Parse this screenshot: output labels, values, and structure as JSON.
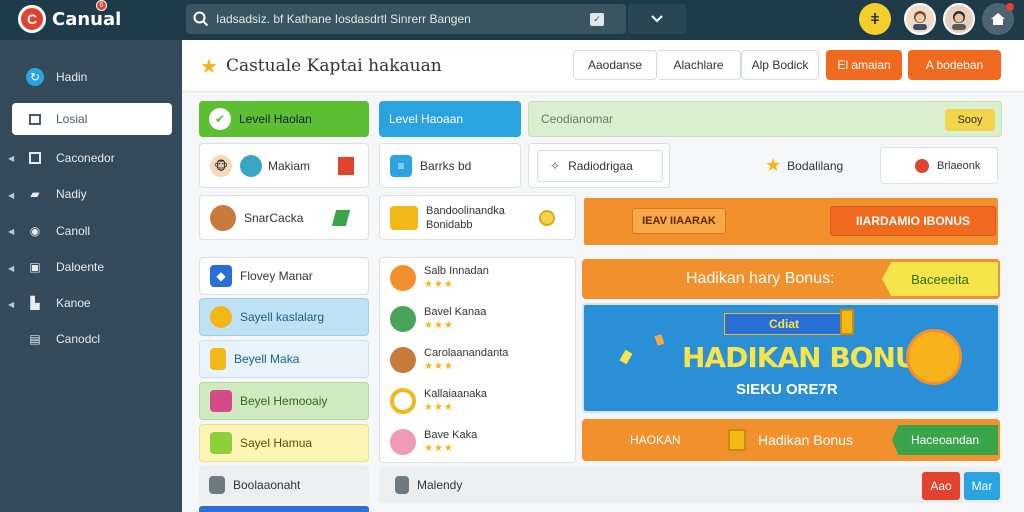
{
  "app": {
    "name": "Canual",
    "badge": "6",
    "logo_glyph": "C"
  },
  "search": {
    "value": "Iadsadsiz. bf Kathane Iosdasdrtl Sinrerr Bangen"
  },
  "topbar": {
    "yellow_badge": "ǂ"
  },
  "sidebar": {
    "items": [
      {
        "label": "Hadin",
        "icon": "refresh-icon"
      },
      {
        "label": "Losial",
        "icon": "square-icon"
      },
      {
        "label": "Caconedor",
        "icon": "calendar-icon"
      },
      {
        "label": "Nadiy",
        "icon": "folder-icon"
      },
      {
        "label": "Canoll",
        "icon": "eye-icon"
      },
      {
        "label": "Daloente",
        "icon": "image-icon"
      },
      {
        "label": "Kanoe",
        "icon": "chart-icon"
      },
      {
        "label": "Canodcl",
        "icon": "list-icon"
      }
    ]
  },
  "header": {
    "title": "Castuale Kaptai hakauan",
    "buttons": [
      "Aaodanse",
      "Alachlare",
      "Alp Bodick",
      "El amaian",
      "A bodeban"
    ]
  },
  "row1": {
    "green": "Leveil Haolan",
    "blue": "Level Haoaan",
    "search_value": "Ceodianomar",
    "search_btn": "Sooy"
  },
  "row2": {
    "card1": "Makiam",
    "card2": "Barrks bd",
    "card3": "Radiodrigaa",
    "card4": "Bodalilang",
    "card5": "Brlaeonk"
  },
  "row3": {
    "card1": "SnarCacka",
    "card2_line1": "Bandoolinandka",
    "card2_line2": "Bonidabb",
    "banner_left": "IEAV IIAARAK",
    "banner_right": "IIARDAMIO IBONUS"
  },
  "left_list": [
    {
      "label": "Flovey Manar"
    },
    {
      "label": "Sayell kaslalarg"
    },
    {
      "label": "Beyell Maka"
    },
    {
      "label": "Beyel Hemooaiy"
    },
    {
      "label": "Sayel Hamua"
    },
    {
      "label": "Boolaaonaht"
    }
  ],
  "mid_list": [
    {
      "label": "Salb Innadan",
      "stars": "★★★"
    },
    {
      "label": "Bavel Kanaa",
      "stars": "★★★"
    },
    {
      "label": "Carolaanandanta",
      "stars": "★★★"
    },
    {
      "label": "Kallaiaanaka",
      "stars": "★★★"
    },
    {
      "label": "Bave Kaka",
      "stars": "★★★"
    }
  ],
  "mid_footer": "Malendy",
  "promo": {
    "bar_text": "Hadikan hary Bonus:",
    "bar_btn": "Baceeeita",
    "hero_small": "Cdiat",
    "hero_title": "HADIKAN BONUS",
    "hero_sub": "SIEKU ORE7R",
    "bottom_left": "HAOKAN",
    "bottom_mid": "Hadikan Bonus",
    "bottom_btn": "Haceoandan",
    "btn_red": "Aao",
    "btn_blue": "Mar"
  },
  "colors": {
    "topbar": "#1f3b4a",
    "sidebar": "#34495a",
    "accent_orange": "#ef6a1f",
    "accent_green": "#5cbf33",
    "accent_blue": "#2aa3e0"
  }
}
